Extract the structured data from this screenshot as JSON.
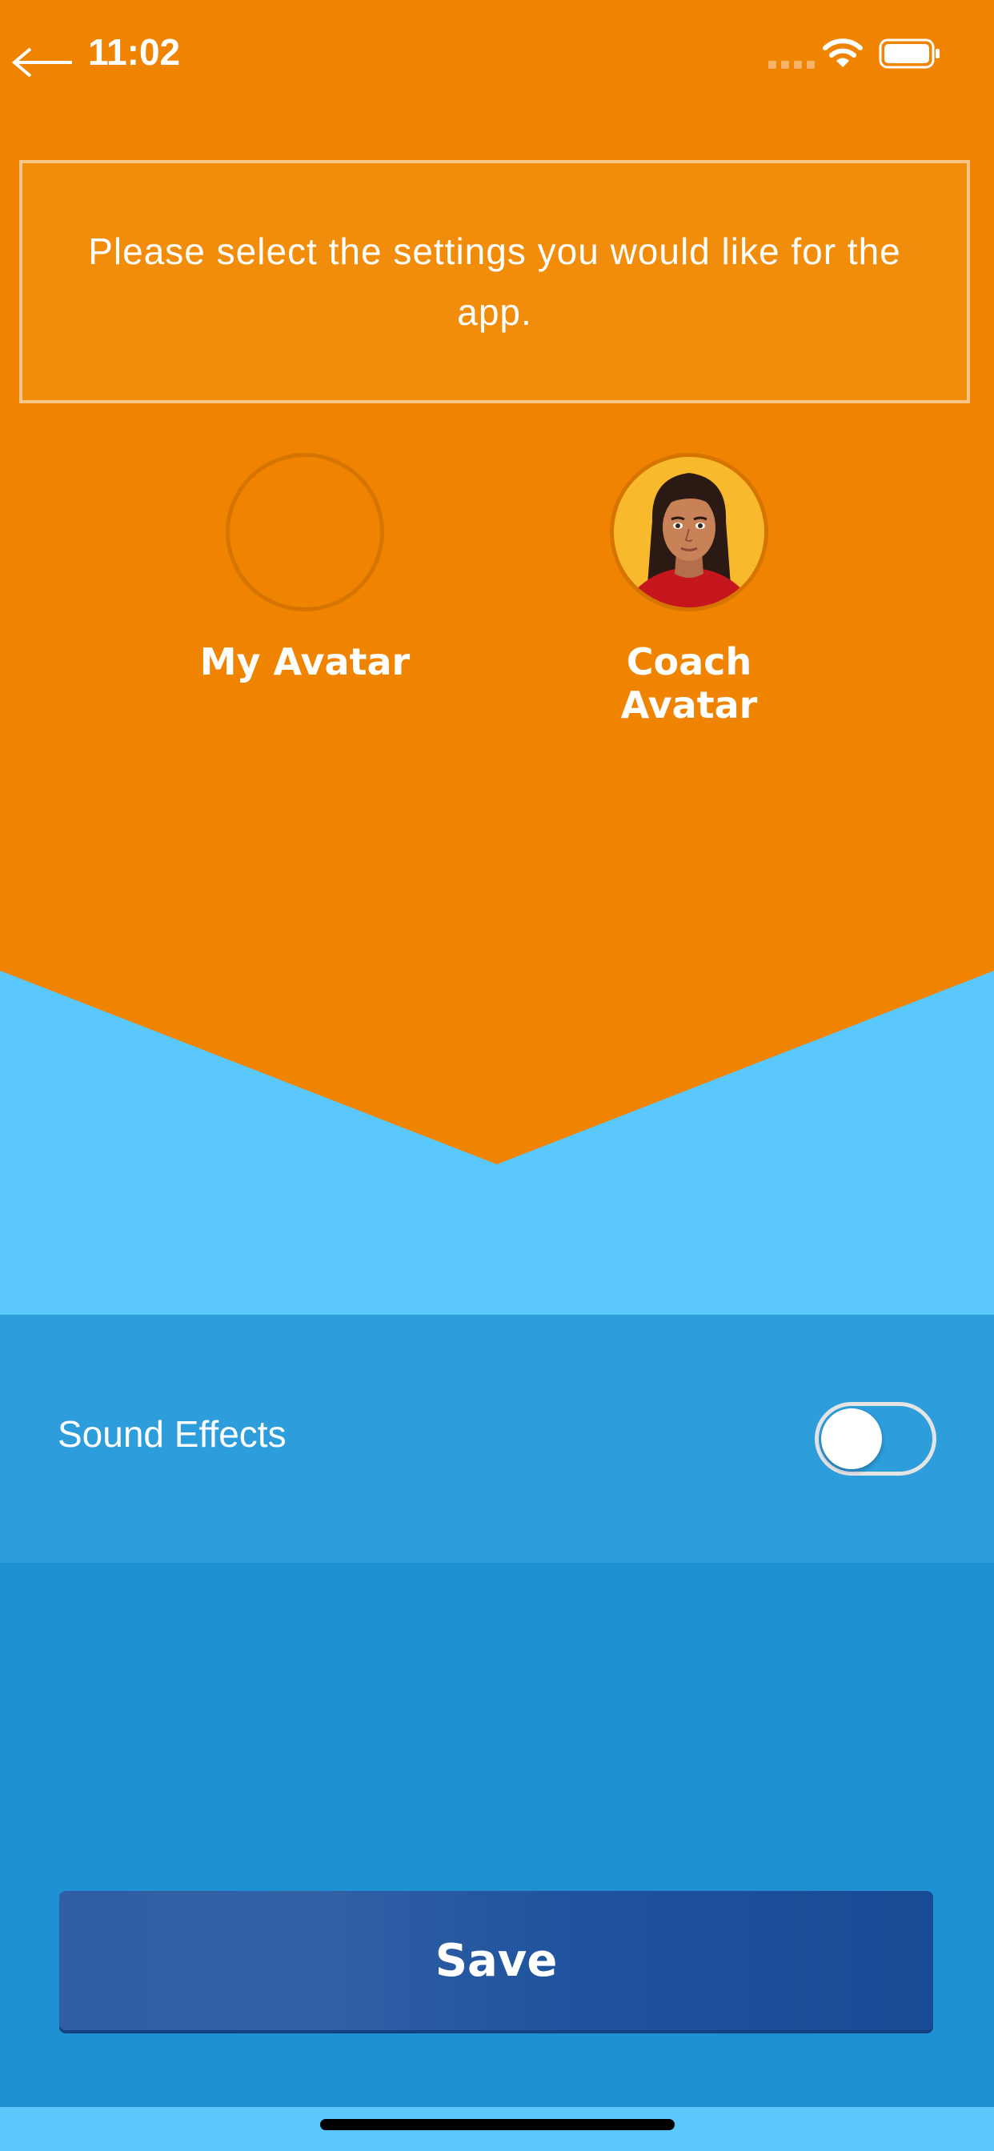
{
  "status_bar": {
    "time": "11:02"
  },
  "message": {
    "text": "Please select the settings you would like for the app."
  },
  "avatars": {
    "my_avatar_label": "My Avatar",
    "coach_avatar_label": "Coach Avatar"
  },
  "settings": {
    "sound_effects_label": "Sound Effects",
    "sound_effects_enabled": false
  },
  "actions": {
    "save_label": "Save"
  },
  "colors": {
    "orange": "#f08300",
    "light_blue": "#5bc8fd",
    "row_blue": "#2d9ddc",
    "panel_blue": "#1f90d1",
    "button_blue": "#1e529e"
  }
}
